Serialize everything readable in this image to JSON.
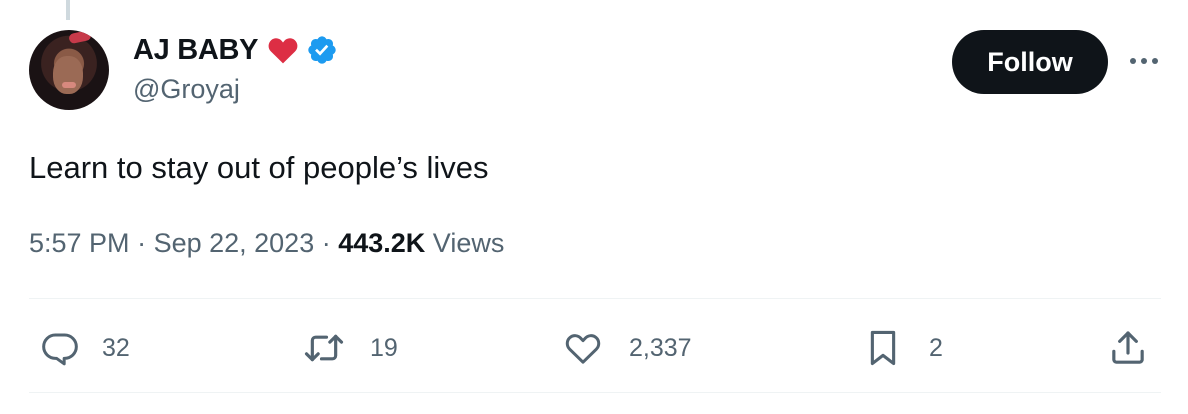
{
  "author": {
    "display_name": "AJ BABY",
    "handle": "@Groyaj",
    "emoji": "red-heart",
    "verified": true
  },
  "follow_button": {
    "label": "Follow"
  },
  "more_menu": {
    "icon": "more-horizontal-icon"
  },
  "tweet": {
    "text": "Learn to stay out of people’s lives",
    "time": "5:57 PM",
    "separator": " · ",
    "date": "Sep 22, 2023",
    "views_count": "443.2K",
    "views_label": " Views"
  },
  "actions": {
    "reply": {
      "icon": "reply-icon",
      "count": "32"
    },
    "retweet": {
      "icon": "retweet-icon",
      "count": "19"
    },
    "like": {
      "icon": "heart-icon",
      "count": "2,337"
    },
    "bookmark": {
      "icon": "bookmark-icon",
      "count": "2"
    },
    "share": {
      "icon": "share-icon"
    }
  },
  "colors": {
    "primary_text": "#0f1419",
    "secondary_text": "#536471",
    "verified_blue": "#1d9bf0",
    "heart_red": "#dd2e44",
    "follow_bg": "#0f1419"
  }
}
